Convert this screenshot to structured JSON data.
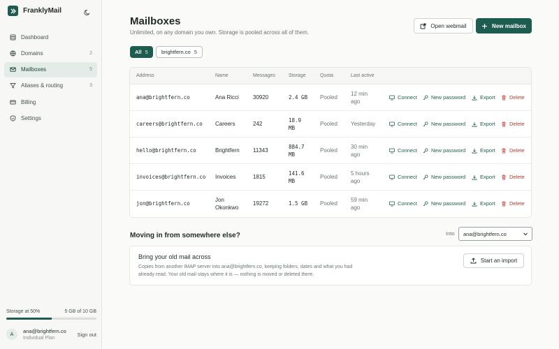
{
  "app": {
    "name": "FranklyMail"
  },
  "sidebar": {
    "items": [
      {
        "label": "Dashboard",
        "icon": "dashboard-icon",
        "count": ""
      },
      {
        "label": "Domains",
        "icon": "globe-icon",
        "count": "2"
      },
      {
        "label": "Mailboxes",
        "icon": "mail-icon",
        "count": "5"
      },
      {
        "label": "Aliases & routing",
        "icon": "filter-icon",
        "count": "3"
      },
      {
        "label": "Billing",
        "icon": "card-icon",
        "count": ""
      },
      {
        "label": "Settings",
        "icon": "shield-icon",
        "count": ""
      }
    ],
    "storage": {
      "label": "Storage at 50%",
      "value": "5 GB of 10 GB",
      "percent": 50
    },
    "user": {
      "initial": "A",
      "email": "ana@brightfern.co",
      "plan": "Individual Plan",
      "signout": "Sign out"
    }
  },
  "header": {
    "title": "Mailboxes",
    "subtitle": "Unlimited, on any domain you own. Storage is pooled across all of them.",
    "open_webmail": "Open webmail",
    "new_mailbox": "New mailbox"
  },
  "filters": [
    {
      "label": "All",
      "count": "5"
    },
    {
      "label": "brightfern.co",
      "count": "5"
    }
  ],
  "table": {
    "headers": [
      "Address",
      "Name",
      "Messages",
      "Storage",
      "Quota",
      "Last active"
    ],
    "actions": {
      "connect": "Connect",
      "new_password": "New password",
      "export": "Export",
      "delete": "Delete"
    },
    "rows": [
      {
        "address": "ana@brightfern.co",
        "name": "Ana Ricci",
        "messages": "30920",
        "storage": "2.4 GB",
        "quota": "Pooled",
        "last_active": "12 min ago"
      },
      {
        "address": "careers@brightfern.co",
        "name": "Careers",
        "messages": "242",
        "storage": "18.9 MB",
        "quota": "Pooled",
        "last_active": "Yesterday"
      },
      {
        "address": "hello@brightfern.co",
        "name": "Brightfern",
        "messages": "11343",
        "storage": "884.7 MB",
        "quota": "Pooled",
        "last_active": "30 min ago"
      },
      {
        "address": "invoices@brightfern.co",
        "name": "Invoices",
        "messages": "1815",
        "storage": "141.6 MB",
        "quota": "Pooled",
        "last_active": "5 hours ago"
      },
      {
        "address": "jon@brightfern.co",
        "name": "Jon Okonkwo",
        "messages": "19272",
        "storage": "1.5 GB",
        "quota": "Pooled",
        "last_active": "59 min ago"
      }
    ]
  },
  "import": {
    "section_title": "Moving in from somewhere else?",
    "into_label": "Into",
    "into_value": "ana@brightfern.co",
    "card_title": "Bring your old mail across",
    "card_desc": "Copies from another IMAP server into ana@brightfern.co, keeping folders, dates and what you had already read. Your old mail stays where it is — nothing is moved or deleted there.",
    "start_button": "Start an import"
  },
  "colors": {
    "accent": "#1d5c4e",
    "danger": "#c0392b"
  }
}
